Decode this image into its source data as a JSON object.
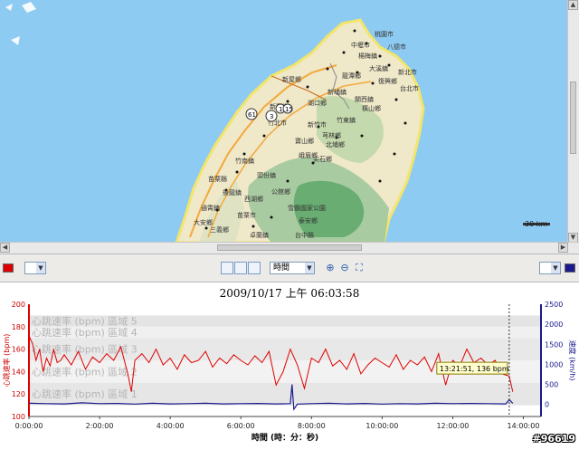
{
  "map": {
    "scale_label": "30 km",
    "place_labels": [
      "新屋鄉",
      "新豐鄉",
      "湖口鄉",
      "竹北市",
      "新竹市",
      "竹東鎮",
      "新埔鎮",
      "關西鎮",
      "芎林鄉",
      "橫山鄉",
      "寶山鄉",
      "北埔鄉",
      "峨眉鄉",
      "尖石鄉",
      "苗栗縣",
      "頭份鎮",
      "竹南鎮",
      "後龍鎮",
      "西湖鄉",
      "通霄鎮",
      "苗栗市",
      "公館鄉",
      "雪霸國家公園",
      "泰安鄉",
      "大安鄉",
      "三義鄉",
      "卓蘭鎮",
      "台中縣",
      "復興鄉",
      "大溪鎮",
      "龍潭鄉",
      "楊梅鎮",
      "中壢市",
      "桃園市",
      "八德市",
      "新北市",
      "台北市"
    ],
    "road_shields": [
      "61",
      "3",
      "1",
      "15"
    ]
  },
  "toolbar": {
    "color_swatch": "#dd0000",
    "axis_mode": "時間",
    "right_swatch": "#1a1a8c"
  },
  "chart_data": {
    "type": "line",
    "title": "2009/10/17 上午 06:03:58",
    "xlabel": "時間 (時：分：秒)",
    "ylabel_left": "心跳速率 (bpm)",
    "ylabel_right": "速度 (km/h)",
    "x_ticks": [
      "0:00:00",
      "2:00:00",
      "4:00:00",
      "6:00:00",
      "8:00:00",
      "10:00:00",
      "12:00:00",
      "14:00:00"
    ],
    "y_ticks_left": [
      100,
      120,
      140,
      160,
      180,
      200
    ],
    "y_ticks_right": [
      0,
      500,
      1000,
      1500,
      2000,
      2500
    ],
    "ylim_left": [
      100,
      200
    ],
    "ylim_right": [
      -300,
      2500
    ],
    "zones": [
      "心跳速率 (bpm) 區域 5",
      "心跳速率 (bpm) 區域 4",
      "心跳速率 (bpm) 區域 3",
      "心跳速率 (bpm) 區域 2",
      "心跳速率 (bpm) 區域 1"
    ],
    "zone_bounds": [
      [
        180,
        190
      ],
      [
        170,
        180
      ],
      [
        150,
        170
      ],
      [
        130,
        150
      ],
      [
        110,
        130
      ]
    ],
    "cursor_time_h": 13.6,
    "tooltip": "13:21:51, 136 bpm",
    "series": [
      {
        "name": "心跳速率 (bpm)",
        "axis": "left",
        "color": "#e00000",
        "x": [
          0,
          0.1,
          0.2,
          0.3,
          0.4,
          0.5,
          0.6,
          0.7,
          0.8,
          0.9,
          1.0,
          1.2,
          1.4,
          1.6,
          1.8,
          2.0,
          2.2,
          2.4,
          2.6,
          2.8,
          2.9,
          3.0,
          3.2,
          3.4,
          3.6,
          3.8,
          4.0,
          4.2,
          4.4,
          4.6,
          4.8,
          5.0,
          5.2,
          5.4,
          5.6,
          5.8,
          6.0,
          6.2,
          6.4,
          6.6,
          6.8,
          7.0,
          7.2,
          7.4,
          7.6,
          7.8,
          8.0,
          8.2,
          8.4,
          8.6,
          8.8,
          9.0,
          9.2,
          9.4,
          9.6,
          9.8,
          10.0,
          10.2,
          10.4,
          10.6,
          10.8,
          11.0,
          11.2,
          11.4,
          11.6,
          11.8,
          12.0,
          12.2,
          12.4,
          12.6,
          12.8,
          13.0,
          13.2,
          13.4,
          13.6,
          13.7
        ],
        "values": [
          172,
          165,
          150,
          160,
          140,
          152,
          145,
          160,
          148,
          150,
          155,
          146,
          158,
          142,
          153,
          148,
          156,
          150,
          162,
          138,
          122,
          150,
          156,
          148,
          160,
          146,
          152,
          142,
          155,
          148,
          150,
          158,
          144,
          152,
          147,
          155,
          150,
          146,
          154,
          148,
          158,
          128,
          140,
          160,
          146,
          125,
          152,
          148,
          160,
          145,
          150,
          142,
          156,
          138,
          146,
          152,
          148,
          144,
          155,
          142,
          150,
          146,
          153,
          140,
          156,
          128,
          150,
          145,
          160,
          148,
          152,
          146,
          150,
          138,
          136,
          122
        ]
      },
      {
        "name": "速度 (km/h)",
        "axis": "right",
        "color": "#1a1a8c",
        "x": [
          0,
          0.5,
          1.0,
          1.5,
          2.0,
          2.5,
          3.0,
          3.5,
          4.0,
          4.5,
          5.0,
          5.5,
          6.0,
          6.5,
          7.0,
          7.4,
          7.45,
          7.5,
          7.6,
          8.0,
          8.5,
          9.0,
          9.5,
          10.0,
          10.5,
          11.0,
          11.5,
          12.0,
          12.5,
          13.0,
          13.5,
          13.6,
          13.7
        ],
        "values": [
          30,
          20,
          15,
          40,
          20,
          25,
          10,
          30,
          15,
          20,
          30,
          15,
          20,
          25,
          15,
          20,
          500,
          -120,
          10,
          20,
          30,
          15,
          25,
          10,
          20,
          15,
          30,
          20,
          25,
          20,
          15,
          120,
          30
        ]
      }
    ]
  }
}
